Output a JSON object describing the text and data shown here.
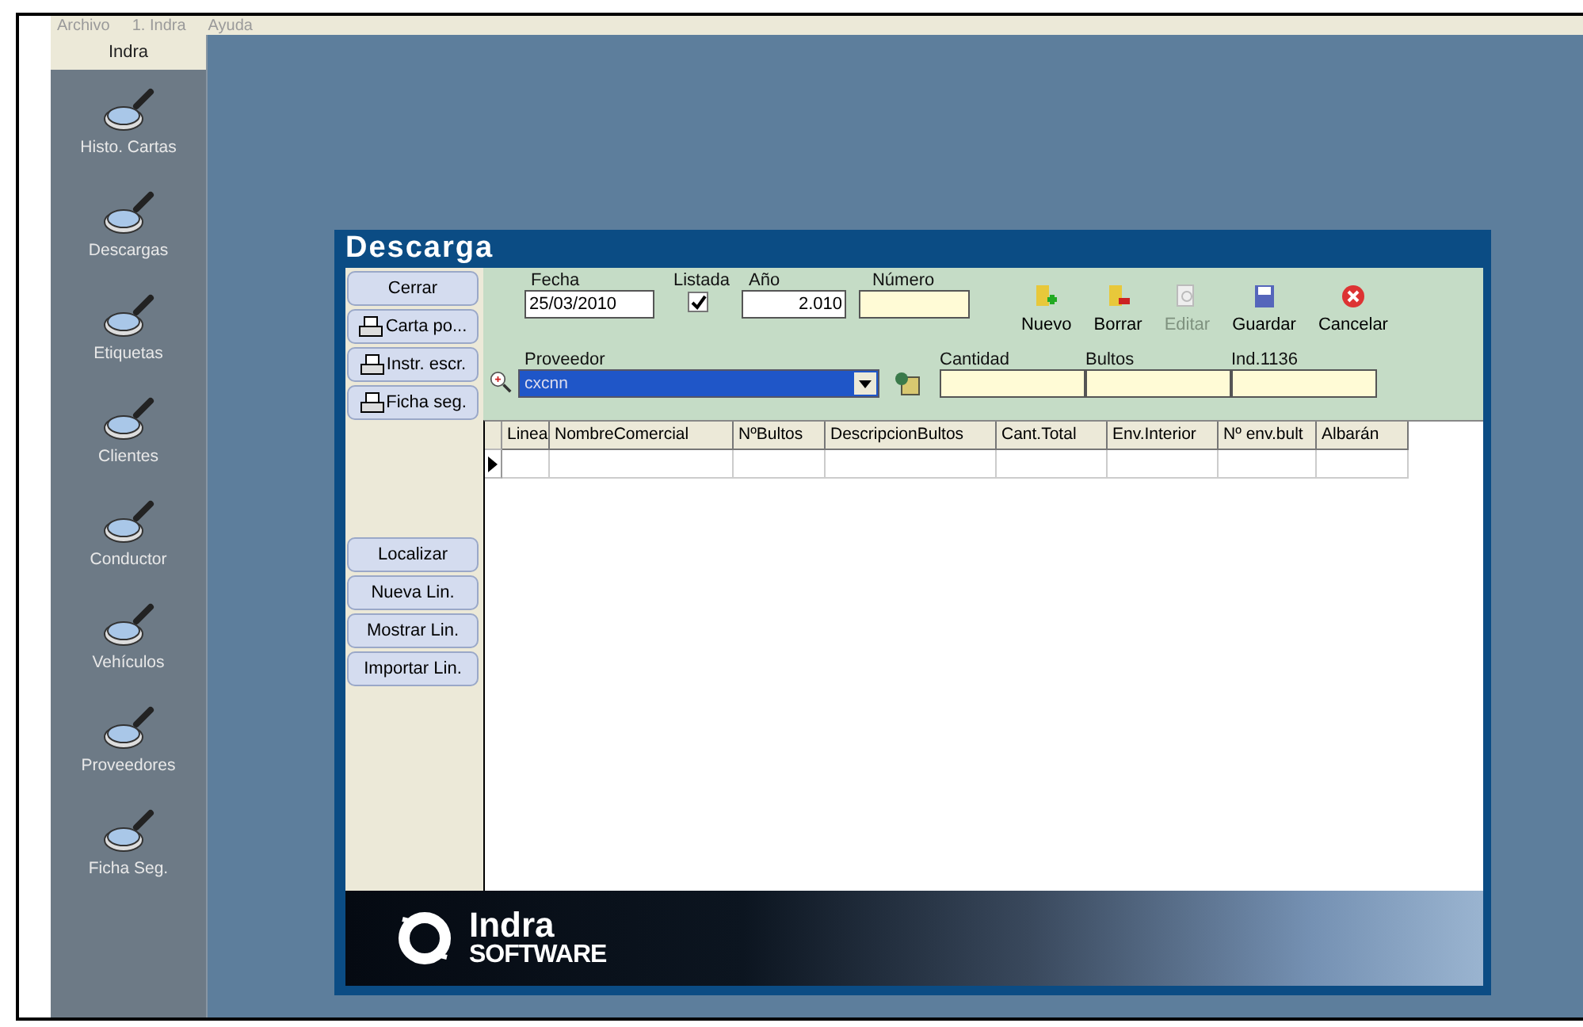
{
  "menu": [
    "Archivo",
    "1. Indra",
    "Ayuda"
  ],
  "sidebar": {
    "title": "Indra",
    "items": [
      {
        "label": "Histo. Cartas"
      },
      {
        "label": "Descargas"
      },
      {
        "label": "Etiquetas"
      },
      {
        "label": "Clientes"
      },
      {
        "label": "Conductor"
      },
      {
        "label": "Vehículos"
      },
      {
        "label": "Proveedores"
      },
      {
        "label": "Ficha Seg."
      }
    ]
  },
  "dialog": {
    "title": "Descarga",
    "side_buttons": [
      {
        "label": "Cerrar",
        "kind": "plain"
      },
      {
        "label": "Carta po...",
        "kind": "print"
      },
      {
        "label": "Instr. escr.",
        "kind": "print"
      },
      {
        "label": "Ficha seg.",
        "kind": "print"
      }
    ],
    "line_buttons": [
      {
        "label": "Localizar"
      },
      {
        "label": "Nueva Lin."
      },
      {
        "label": "Mostrar Lin."
      },
      {
        "label": "Importar Lin."
      }
    ],
    "fecha": {
      "label": "Fecha",
      "value": "25/03/2010"
    },
    "listada": {
      "label": "Listada",
      "checked": true
    },
    "anio": {
      "label": "Año",
      "value": "2.010"
    },
    "numero": {
      "label": "Número"
    },
    "proveedor": {
      "label": "Proveedor",
      "value": "cxcnn"
    },
    "toolbar": [
      {
        "label": "Nuevo",
        "kind": "new",
        "disabled": false
      },
      {
        "label": "Borrar",
        "kind": "delete",
        "disabled": false
      },
      {
        "label": "Editar",
        "kind": "edit",
        "disabled": true
      },
      {
        "label": "Guardar",
        "kind": "save",
        "disabled": false
      },
      {
        "label": "Cancelar",
        "kind": "cancel",
        "disabled": false
      }
    ],
    "totals": [
      {
        "label": "Cantidad"
      },
      {
        "label": "Bultos"
      },
      {
        "label": "Ind.1136"
      }
    ],
    "table": {
      "columns": [
        "Linea",
        "NombreComercial",
        "NºBultos",
        "DescripcionBultos",
        "Cant.Total",
        "Env.Interior",
        "Nº env.bult",
        "Albarán"
      ],
      "rows": [
        {
          "current": true,
          "cells": [
            "",
            "",
            "",
            "",
            "",
            "",
            "",
            ""
          ]
        }
      ]
    },
    "footer": {
      "brand": "Indra",
      "sub": "SOFTWARE"
    }
  }
}
